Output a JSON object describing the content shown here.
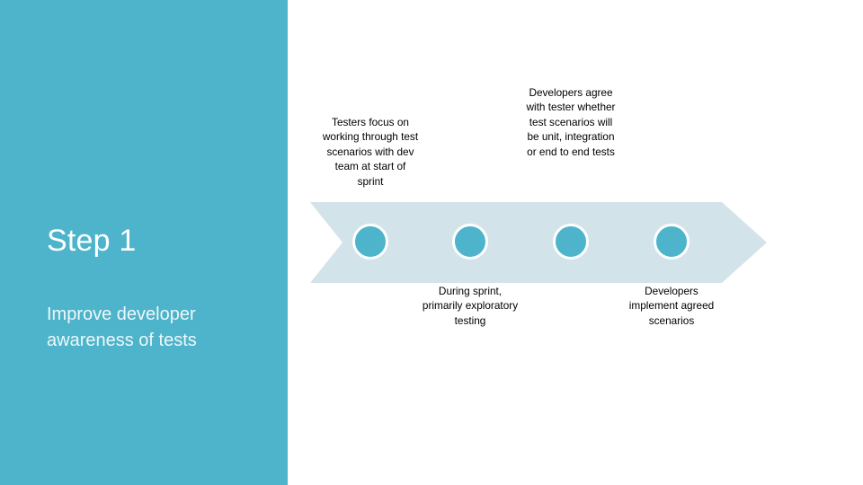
{
  "slide": {
    "background_color": "#ffffff",
    "sidebar": {
      "background_color": "#4db4cb",
      "title": "Step 1",
      "subtitle": "Improve developer awareness of tests",
      "title_color": "#ffffff",
      "subtitle_color": "#eef8fa"
    },
    "process_arrow": {
      "shape": "chevron-arrow-right",
      "fill_color": "#d3e3ea",
      "marker_fill_color": "#4db4cb",
      "marker_border_color": "#ffffff",
      "marker_count": 4
    },
    "callouts": [
      {
        "id": "callout-1",
        "position": "above",
        "marker": 1,
        "text": "Testers focus on working through test scenarios with dev team at start of sprint"
      },
      {
        "id": "callout-2",
        "position": "below",
        "marker": 2,
        "text": "During sprint, primarily exploratory testing"
      },
      {
        "id": "callout-3",
        "position": "above",
        "marker": 3,
        "text": "Developers agree with tester whether test scenarios will be unit, integration or end to end tests"
      },
      {
        "id": "callout-4",
        "position": "below",
        "marker": 4,
        "text": "Developers implement agreed scenarios"
      }
    ]
  }
}
